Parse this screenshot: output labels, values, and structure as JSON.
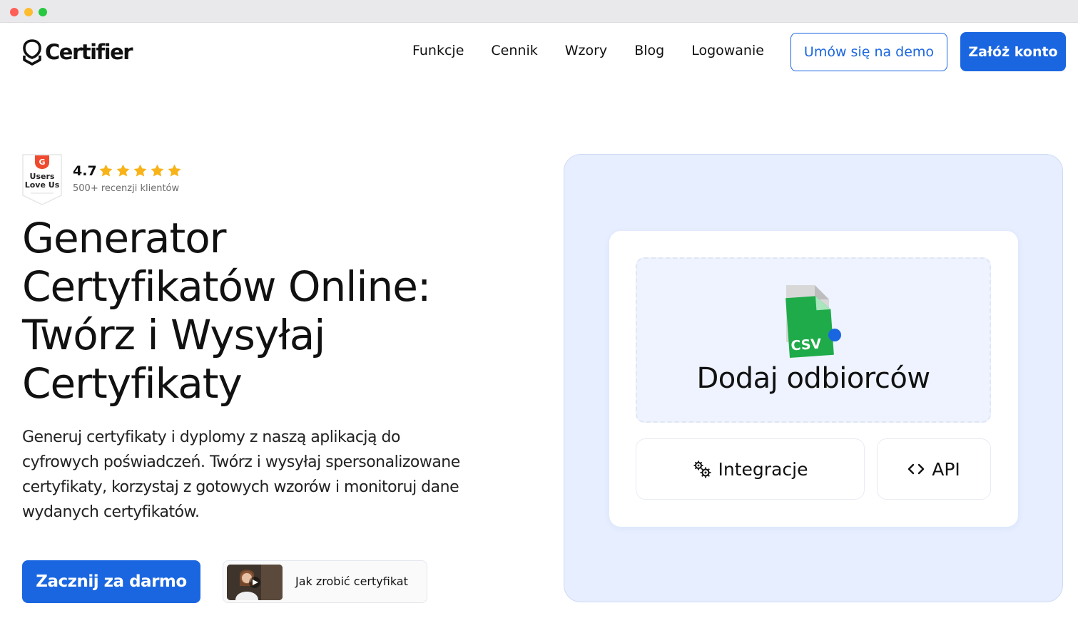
{
  "brand": {
    "name": "Certifier",
    "accent": "#1a66e0"
  },
  "nav": {
    "items": [
      {
        "label": "Funkcje"
      },
      {
        "label": "Cennik"
      },
      {
        "label": "Wzory"
      },
      {
        "label": "Blog"
      },
      {
        "label": "Logowanie"
      }
    ],
    "demo_label": "Umów się na demo",
    "signup_label": "Załóż konto"
  },
  "rating": {
    "badge_brand": "G",
    "badge_line1": "Users",
    "badge_line2": "Love Us",
    "value": "4.7",
    "stars": 5,
    "reviews_label": "500+ recenzji klientów"
  },
  "hero": {
    "title_lines": [
      "Generator",
      "Certyfikatów Online:",
      "Twórz i Wysyłaj",
      "Certyfikaty"
    ],
    "subtitle": "Generuj certyfikaty i dyplomy z naszą aplikacją do cyfrowych poświadczeń. Twórz i wysyłaj spersonalizowane certyfikaty, korzystaj z gotowych wzorów i monitoruj dane wydanych certyfikatów.",
    "cta_label": "Zacznij za darmo",
    "video_label": "Jak zrobić certyfikat"
  },
  "panel": {
    "file_type": "CSV",
    "drop_title": "Dodaj odbiorców",
    "integrations_label": "Integracje",
    "api_label": "API"
  }
}
